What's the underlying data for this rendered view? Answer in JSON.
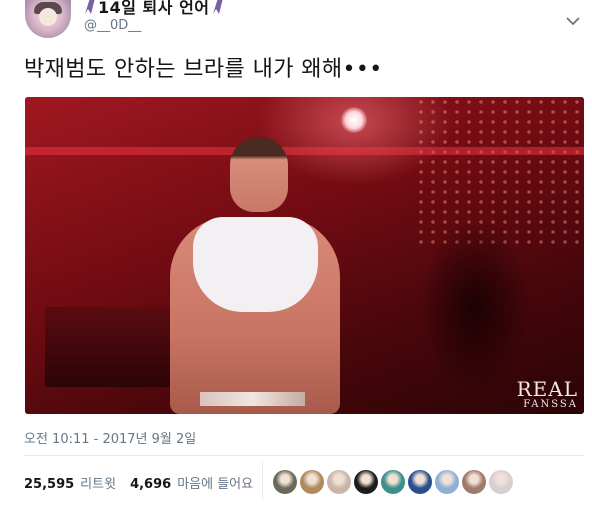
{
  "author": {
    "display_name": "14일 퇴사 언어",
    "handle": "@__0D__",
    "ribbon_color": "#7b5ea7"
  },
  "tweet": {
    "text": "박재범도 안하는 브라를 내가 왜해•••",
    "timestamp": "오전 10:11 - 2017년 9월 2일"
  },
  "media": {
    "watermark_main": "REAL",
    "watermark_sub": "FANSSA",
    "dominant_color": "#a01821"
  },
  "stats": {
    "retweets_count": "25,595",
    "retweets_label": "리트윗",
    "likes_count": "4,696",
    "likes_label": "마음에 들어요"
  },
  "likers": [
    {
      "icon": "avatar-1",
      "color": "#6b6a5a"
    },
    {
      "icon": "avatar-2",
      "color": "#b08a5e"
    },
    {
      "icon": "avatar-3",
      "color": "#c9b6a8"
    },
    {
      "icon": "avatar-4",
      "color": "#1c1c1c"
    },
    {
      "icon": "avatar-5",
      "color": "#3c8f8a"
    },
    {
      "icon": "avatar-6",
      "color": "#2a4f8c"
    },
    {
      "icon": "avatar-7",
      "color": "#8fb0d6"
    },
    {
      "icon": "avatar-8",
      "color": "#a07a6a"
    },
    {
      "icon": "avatar-9",
      "color": "#d8cfd0"
    }
  ],
  "colors": {
    "text_primary": "#14171a",
    "text_secondary": "#657786",
    "divider": "#e6ecf0"
  }
}
